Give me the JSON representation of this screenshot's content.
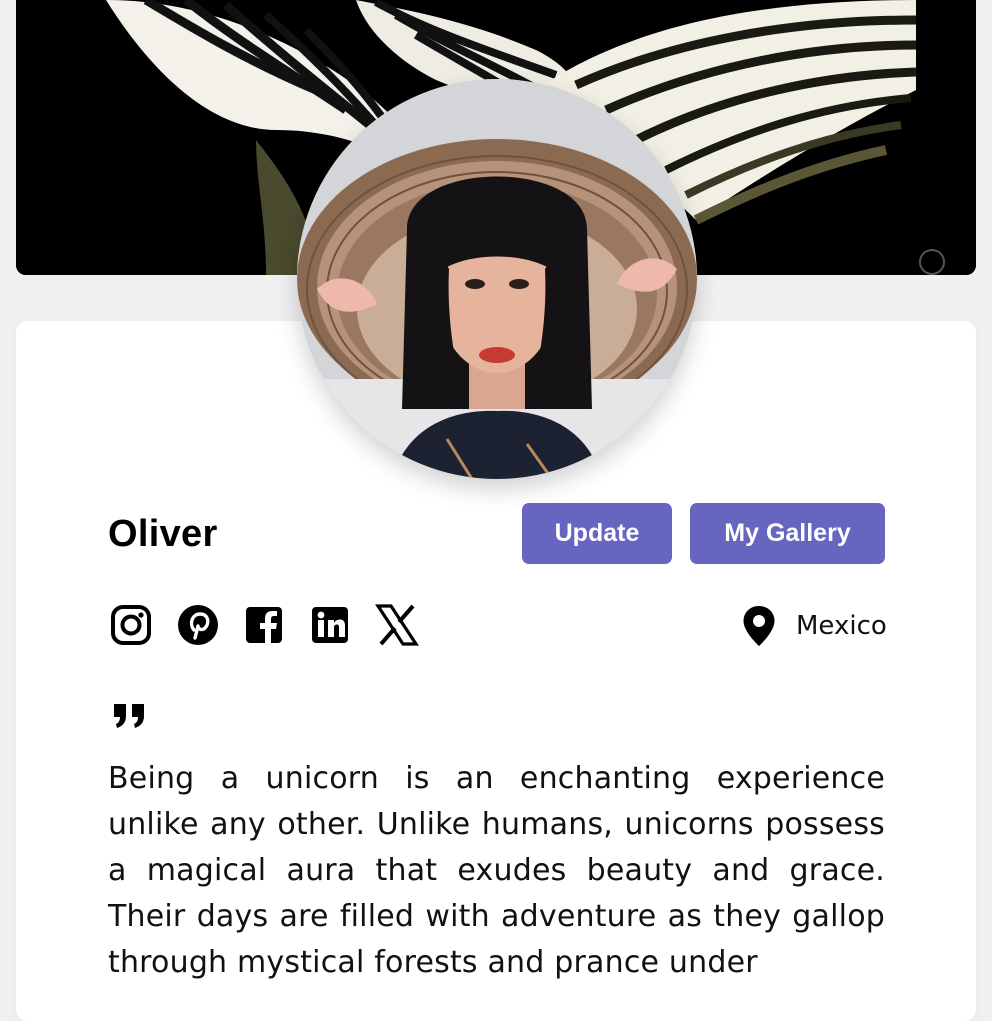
{
  "profile": {
    "name": "Oliver",
    "location": "Mexico",
    "bio": "Being a unicorn is an enchanting experience unlike any other. Unlike humans, unicorns possess a magical aura that exudes beauty and grace. Their days are filled with adventure as they gallop through mystical forests and prance under"
  },
  "actions": {
    "update_label": "Update",
    "gallery_label": "My Gallery"
  },
  "social": [
    "instagram-icon",
    "pinterest-icon",
    "facebook-icon",
    "linkedin-icon",
    "x-icon"
  ],
  "icons": {
    "location": "map-pin-icon",
    "quote": "quote-icon"
  },
  "colors": {
    "accent": "#6665c0",
    "background": "#f1f0f1",
    "card": "#ffffff"
  },
  "images": {
    "cover": "black and white striped abstract shape on black background",
    "avatar": "woman with bob haircut wearing a conical straw hat with pink ribbons"
  }
}
